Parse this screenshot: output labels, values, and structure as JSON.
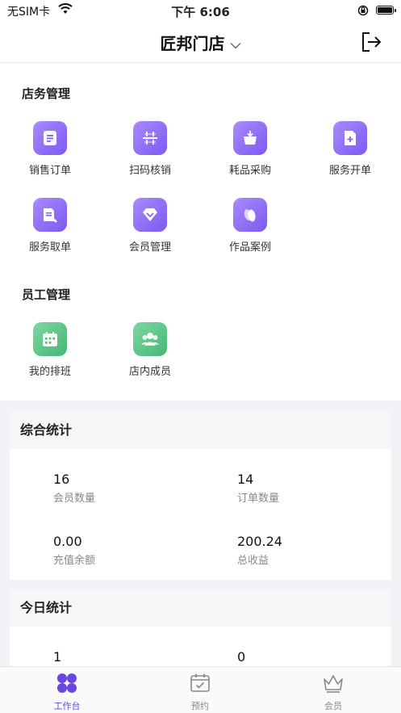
{
  "status_bar": {
    "carrier": "无SIM卡",
    "time": "下午 6:06"
  },
  "nav": {
    "title": "匠邦门店"
  },
  "store_section": {
    "title": "店务管理",
    "items": [
      {
        "label": "销售订单",
        "icon": "order-list-icon"
      },
      {
        "label": "扫码核销",
        "icon": "scan-icon"
      },
      {
        "label": "耗品采购",
        "icon": "basket-icon"
      },
      {
        "label": "服务开单",
        "icon": "add-document-icon"
      },
      {
        "label": "服务取单",
        "icon": "take-document-icon"
      },
      {
        "label": "会员管理",
        "icon": "diamond-icon"
      },
      {
        "label": "作品案例",
        "icon": "cards-icon"
      }
    ]
  },
  "staff_section": {
    "title": "员工管理",
    "items": [
      {
        "label": "我的排班",
        "icon": "calendar-icon"
      },
      {
        "label": "店内成员",
        "icon": "team-icon"
      }
    ]
  },
  "overall_stats": {
    "title": "综合统计",
    "items": [
      {
        "value": "16",
        "label": "会员数量"
      },
      {
        "value": "14",
        "label": "订单数量"
      },
      {
        "value": "0.00",
        "label": "充值余额"
      },
      {
        "value": "200.24",
        "label": "总收益"
      }
    ]
  },
  "today_stats": {
    "title": "今日统计",
    "items": [
      {
        "value": "1"
      },
      {
        "value": "0"
      }
    ]
  },
  "tab_bar": {
    "tabs": [
      {
        "label": "工作台",
        "active": true
      },
      {
        "label": "预约",
        "active": false
      },
      {
        "label": "会员",
        "active": false
      }
    ]
  },
  "colors": {
    "accent": "#7c59f0",
    "green": "#45b775",
    "background": "#f2f2f6"
  }
}
